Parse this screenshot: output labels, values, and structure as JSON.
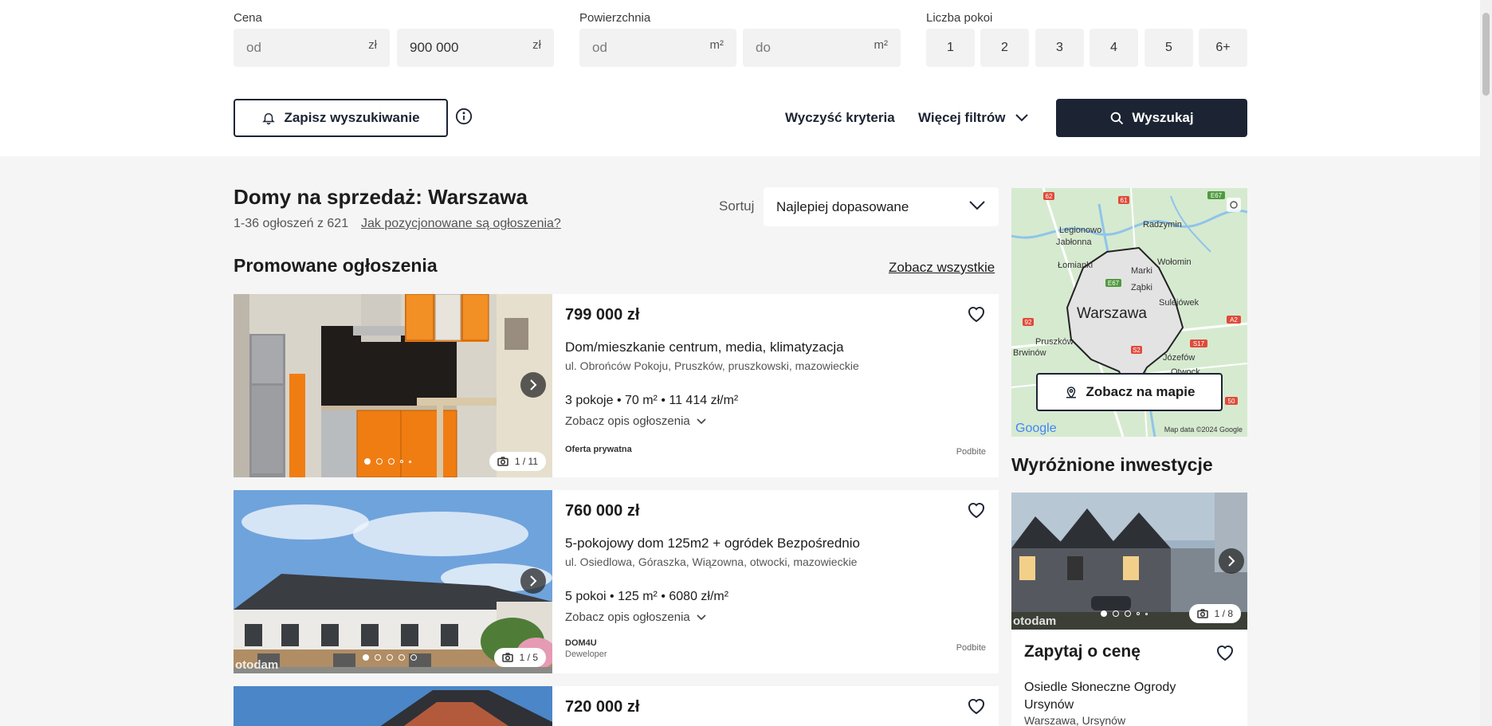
{
  "filters": {
    "price_label": "Cena",
    "price_from": "od",
    "price_to": "900 000",
    "currency": "zł",
    "area_label": "Powierzchnia",
    "area_from": "od",
    "area_to": "do",
    "area_unit": "m²",
    "rooms_label": "Liczba pokoi",
    "rooms": [
      "1",
      "2",
      "3",
      "4",
      "5",
      "6+"
    ]
  },
  "actions": {
    "save_search": "Zapisz wyszukiwanie",
    "clear": "Wyczyść kryteria",
    "more_filters": "Więcej filtrów",
    "search": "Wyszukaj"
  },
  "results": {
    "heading": "Domy na sprzedaż: Warszawa",
    "count": "1-36 ogłoszeń z 621",
    "how_positioned": "Jak pozycjonowane są ogłoszenia?",
    "sort_label": "Sortuj",
    "sort_value": "Najlepiej dopasowane",
    "promoted_heading": "Promowane ogłoszenia",
    "see_all": "Zobacz wszystkie"
  },
  "listings": [
    {
      "price": "799 000 zł",
      "title": "Dom/mieszkanie centrum, media, klimatyzacja",
      "address": "ul. Obrońców Pokoju, Pruszków, pruszkowski, mazowieckie",
      "params": "3 pokoje • 70 m² • 11 414 zł/m²",
      "desc_link": "Zobacz opis ogłoszenia",
      "seller": "Oferta prywatna",
      "seller_type": "",
      "badge": "Podbite",
      "photo_count": "1 / 11"
    },
    {
      "price": "760 000 zł",
      "title": "5-pokojowy dom 125m2 + ogródek Bezpośrednio",
      "address": "ul. Osiedlowa, Góraszka, Wiązowna, otwocki, mazowieckie",
      "params": "5 pokoi • 125 m² • 6080 zł/m²",
      "desc_link": "Zobacz opis ogłoszenia",
      "seller": "DOM4U",
      "seller_type": "Deweloper",
      "badge": "Podbite",
      "photo_count": "1 / 5",
      "watermark": "otodam"
    },
    {
      "price": "720 000 zł"
    }
  ],
  "map": {
    "button": "Zobacz na mapie",
    "city": "Warszawa",
    "places": [
      "Legionowo",
      "Jabłonna",
      "Radzymin",
      "Łomianki",
      "Marki",
      "Wołomin",
      "Ząbki",
      "Sulejówek",
      "Pruszków",
      "Brwinów",
      "Józefów",
      "Otwock"
    ],
    "roads": [
      "62",
      "61",
      "E67",
      "E67",
      "92",
      "S2",
      "S17",
      "A2",
      "50"
    ],
    "google": "Google",
    "attribution": "Map data ©2024 Google"
  },
  "featured": {
    "heading": "Wyróżnione inwestycje",
    "price": "Zapytaj o cenę",
    "name": "Osiedle Słoneczne Ogrody Ursynów",
    "location": "Warszawa, Ursynów",
    "photo_count": "1 / 8",
    "watermark": "otodam"
  }
}
